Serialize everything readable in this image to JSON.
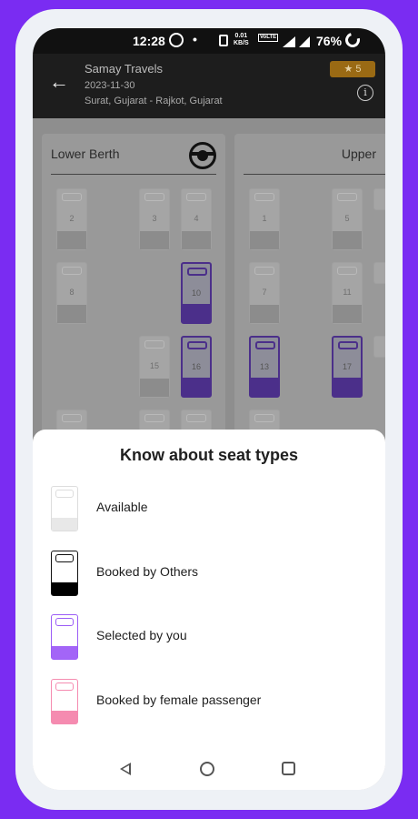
{
  "status_bar": {
    "time": "12:28",
    "net_speed": "0.01\nKB/S",
    "volte": "VoLTE",
    "battery": "76%"
  },
  "header": {
    "operator": "Samay Travels",
    "date": "2023-11-30",
    "route": "Surat, Gujarat - Rajkot, Gujarat",
    "rating": "★ 5",
    "info_icon": "info-icon",
    "back_icon": "arrow-left-icon"
  },
  "decks": {
    "lower": {
      "title": "Lower Berth",
      "seats": [
        {
          "num": "2",
          "selected": false
        },
        {
          "num": "3",
          "selected": false
        },
        {
          "num": "4",
          "selected": false
        },
        {
          "num": "8",
          "selected": false
        },
        {
          "num": "10",
          "selected": true
        },
        {
          "num": "15",
          "selected": false
        },
        {
          "num": "16",
          "selected": true
        }
      ]
    },
    "upper": {
      "title": "Upper",
      "seats": [
        {
          "num": "1",
          "selected": false
        },
        {
          "num": "5",
          "selected": false
        },
        {
          "num": "7",
          "selected": false
        },
        {
          "num": "11",
          "selected": false
        },
        {
          "num": "13",
          "selected": true
        },
        {
          "num": "17",
          "selected": true
        }
      ]
    }
  },
  "sheet": {
    "heading": "Know about seat types",
    "legend": [
      {
        "label": "Available",
        "color": "#e8e8e8"
      },
      {
        "label": "Booked by Others",
        "color": "#000000"
      },
      {
        "label": "Selected by you",
        "color": "#a365f7"
      },
      {
        "label": "Booked by female passenger",
        "color": "#f58bb0"
      }
    ]
  },
  "colors": {
    "frame_background": "#7a2cf2",
    "selected_seat": "#4b2f8a",
    "rating_badge": "#9a6a14"
  }
}
